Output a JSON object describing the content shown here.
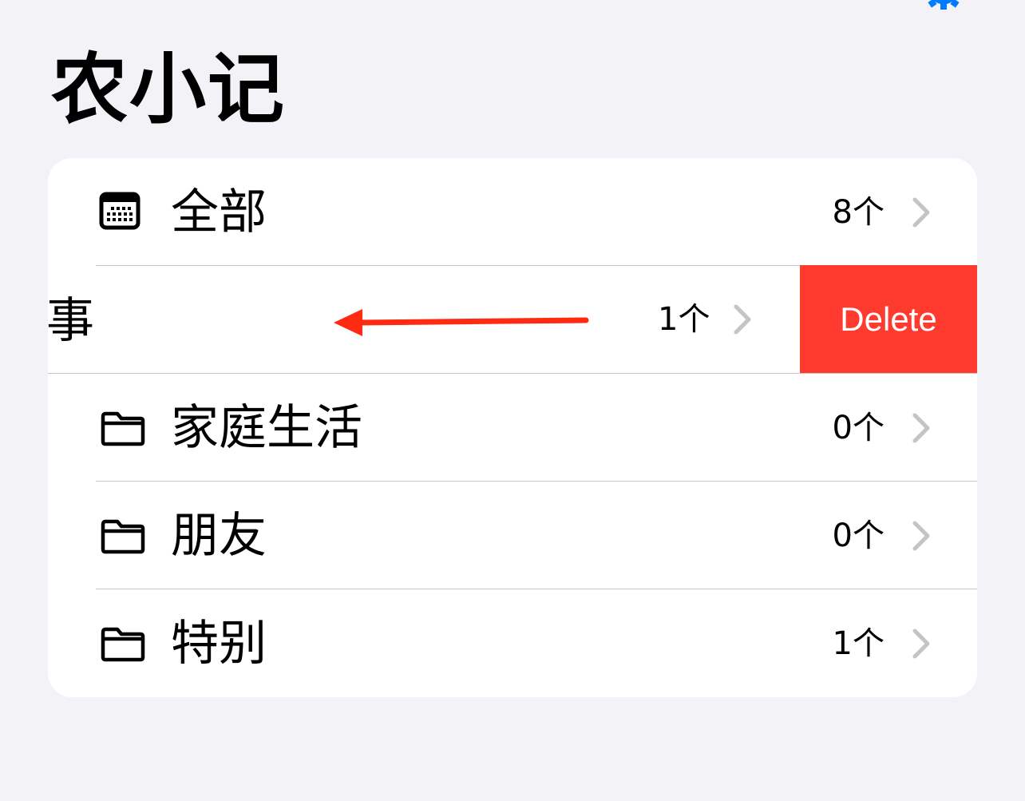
{
  "header": {
    "title": "农小记",
    "settings_icon": "gear-icon",
    "accent_color": "#007aff"
  },
  "folders": [
    {
      "label": "全部",
      "count": "8个",
      "icon": "calendar-icon"
    },
    {
      "label": "事",
      "count": "1个",
      "icon": "folder-icon",
      "swiped": true,
      "action_label": "Delete",
      "action_color": "#ff3b30"
    },
    {
      "label": "家庭生活",
      "count": "0个",
      "icon": "folder-icon"
    },
    {
      "label": "朋友",
      "count": "0个",
      "icon": "folder-icon"
    },
    {
      "label": "特别",
      "count": "1个",
      "icon": "folder-icon"
    }
  ],
  "annotation": {
    "type": "swipe-left-arrow",
    "color": "#ff2a12"
  }
}
